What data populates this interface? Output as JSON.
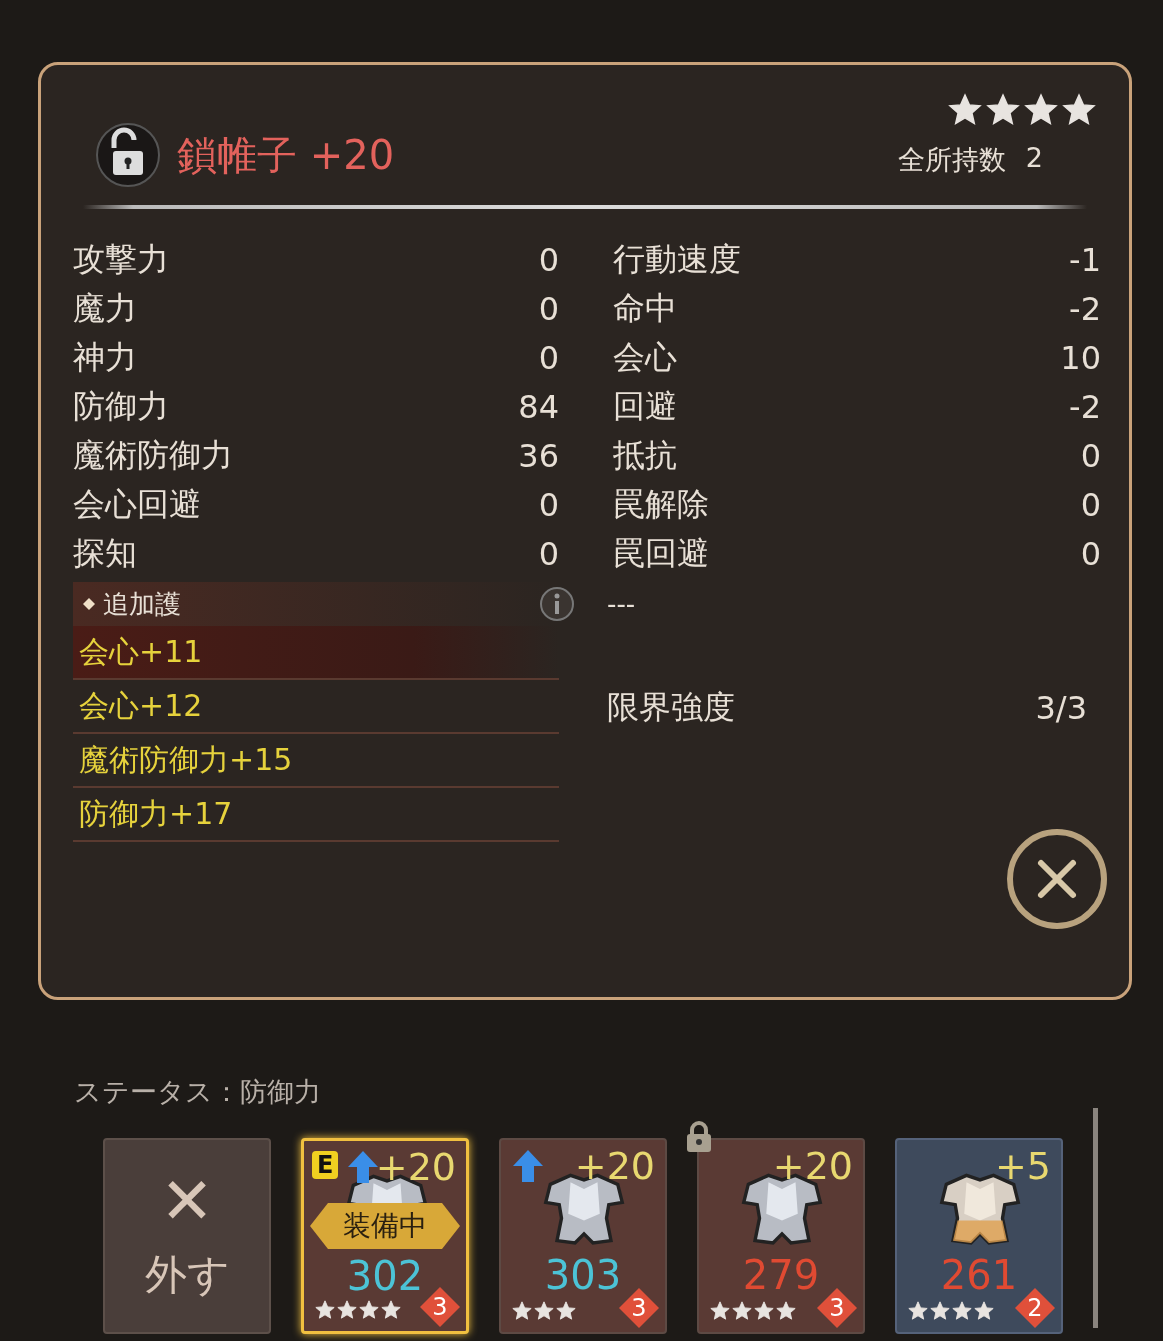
{
  "item": {
    "title": "鎖帷子 +20",
    "locked": false,
    "stars": 4,
    "owned_label": "全所持数",
    "owned_count": "2"
  },
  "left_stats": [
    {
      "name": "攻撃力",
      "value": "0"
    },
    {
      "name": "魔力",
      "value": "0"
    },
    {
      "name": "神力",
      "value": "0"
    },
    {
      "name": "防御力",
      "value": "84"
    },
    {
      "name": "魔術防御力",
      "value": "36"
    },
    {
      "name": "会心回避",
      "value": "0"
    },
    {
      "name": "探知",
      "value": "0"
    }
  ],
  "right_stats": [
    {
      "name": "行動速度",
      "value": "-1"
    },
    {
      "name": "命中",
      "value": "-2"
    },
    {
      "name": "会心",
      "value": "10"
    },
    {
      "name": "回避",
      "value": "-2"
    },
    {
      "name": "抵抗",
      "value": "0"
    },
    {
      "name": "罠解除",
      "value": "0"
    },
    {
      "name": "罠回避",
      "value": "0"
    }
  ],
  "extra": {
    "title": "追加護",
    "right_value": "---",
    "abilities": [
      {
        "text": "会心+11",
        "selected": true
      },
      {
        "text": "会心+12",
        "selected": false
      },
      {
        "text": "魔術防御力+15",
        "selected": false
      },
      {
        "text": "防御力+17",
        "selected": false
      }
    ]
  },
  "limit": {
    "label": "限界強度",
    "value": "3/3"
  },
  "status_label": "ステータス：防御力",
  "unequip": {
    "icon": "✕",
    "label": "外す"
  },
  "cards": [
    {
      "plus": "+20",
      "value": "302",
      "color": "#4cc3d6",
      "stars": 4,
      "rank": "3",
      "selected": true,
      "equipped": true,
      "equipped_badge": "E",
      "equipped_label": "装備中",
      "upgrade": true,
      "locked": false,
      "kind": "normal"
    },
    {
      "plus": "+20",
      "value": "303",
      "color": "#4cc3d6",
      "stars": 3,
      "rank": "3",
      "selected": false,
      "equipped": false,
      "upgrade": true,
      "locked": false,
      "kind": "normal"
    },
    {
      "plus": "+20",
      "value": "279",
      "color": "#e04a32",
      "stars": 4,
      "rank": "3",
      "selected": false,
      "equipped": false,
      "upgrade": false,
      "locked": true,
      "kind": "normal"
    },
    {
      "plus": "+5",
      "value": "261",
      "color": "#e04a32",
      "stars": 4,
      "rank": "2",
      "selected": false,
      "equipped": false,
      "upgrade": false,
      "locked": false,
      "kind": "rare"
    }
  ]
}
